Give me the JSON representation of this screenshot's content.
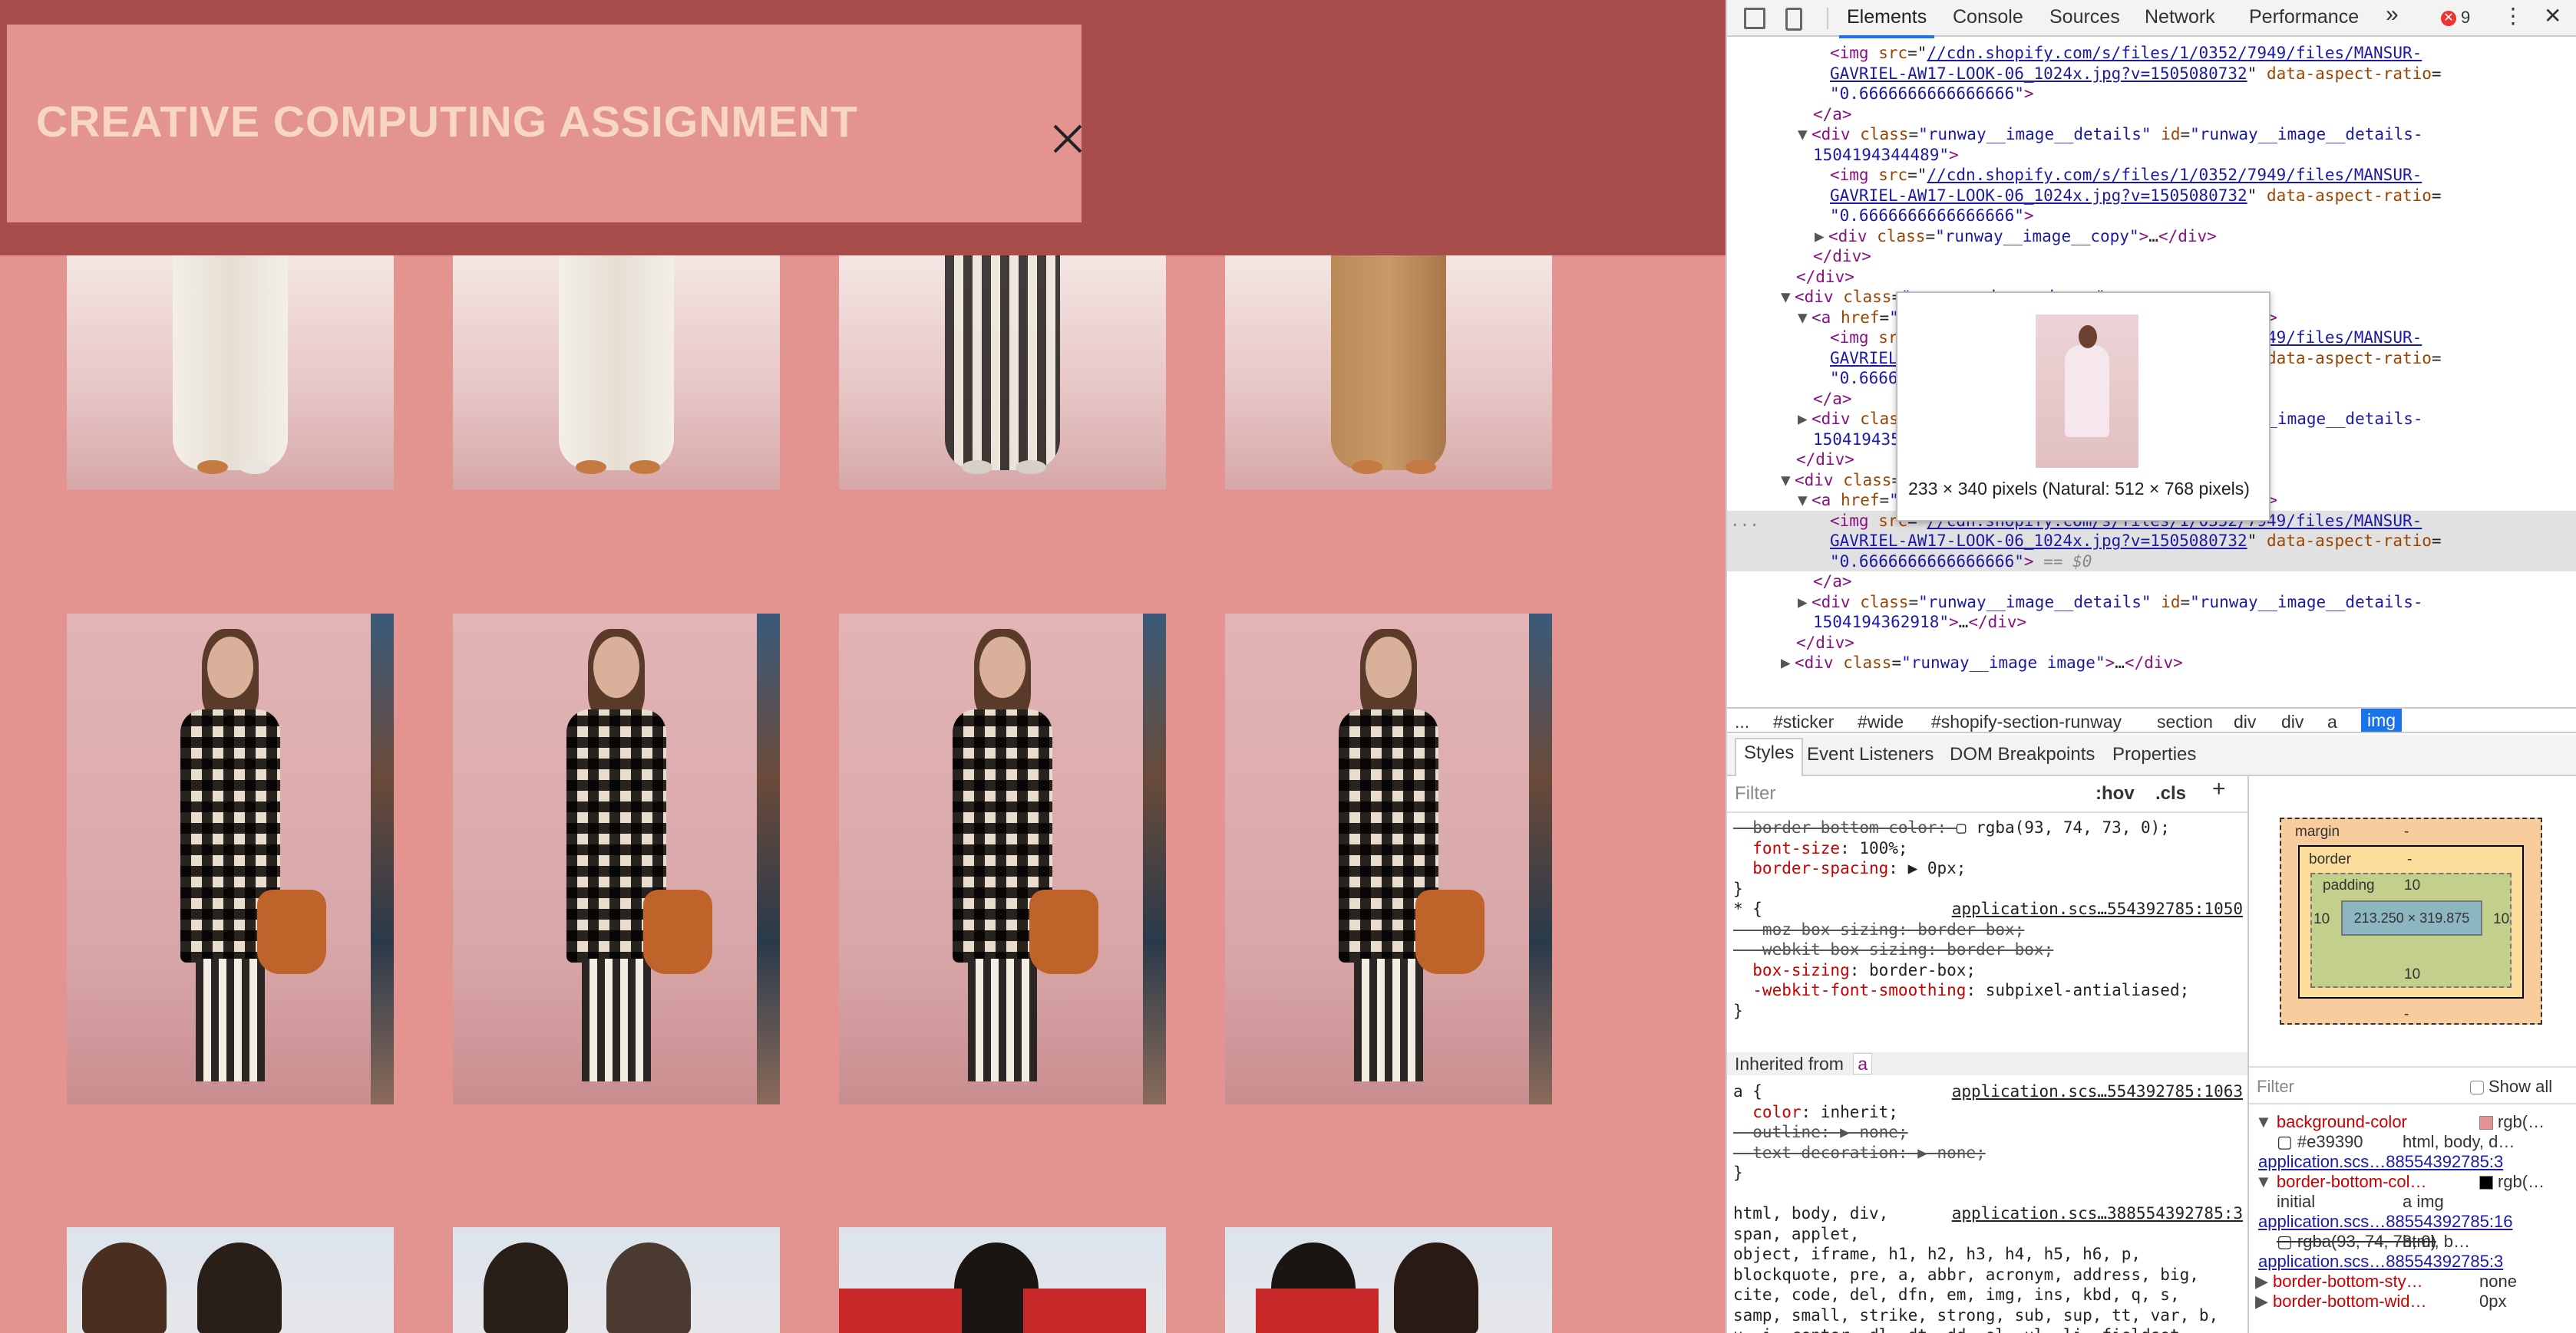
{
  "modal": {
    "title": "CREATIVE COMPUTING ASSIGNMENT",
    "close_icon": "close-icon"
  },
  "devtools": {
    "tabs": [
      "Elements",
      "Console",
      "Sources",
      "Network",
      "Performance"
    ],
    "more_tabs": "»",
    "error_count": "9",
    "error_icon": "error-icon",
    "dom_lines": [
      {
        "indent": 5,
        "parts": [
          [
            "tag",
            "<img "
          ],
          [
            "attr",
            "src"
          ],
          [
            "plain",
            "=\""
          ],
          [
            "link",
            "//cdn.shopify.com/s/files/1/0352/7949/files/MANSUR-"
          ]
        ]
      },
      {
        "indent": 5,
        "parts": [
          [
            "link",
            "GAVRIEL-AW17-LOOK-06_1024x.jpg?v=1505080732"
          ],
          [
            "plain",
            "\" "
          ],
          [
            "attr",
            "data-aspect-ratio"
          ],
          [
            "plain",
            "="
          ]
        ]
      },
      {
        "indent": 5,
        "parts": [
          [
            "val",
            "\"0.6666666666666666\""
          ],
          [
            "tag",
            ">"
          ]
        ]
      },
      {
        "indent": 4,
        "parts": [
          [
            "tag",
            "</a>"
          ]
        ]
      },
      {
        "indent": 4,
        "tri": "▼",
        "parts": [
          [
            "tag",
            "<div "
          ],
          [
            "attr",
            "class"
          ],
          [
            "plain",
            "="
          ],
          [
            "val",
            "\"runway__image__details\""
          ],
          [
            "plain",
            " "
          ],
          [
            "attr",
            "id"
          ],
          [
            "plain",
            "="
          ],
          [
            "val",
            "\"runway__image__details-"
          ]
        ]
      },
      {
        "indent": 4,
        "parts": [
          [
            "val",
            "1504194344489\""
          ],
          [
            "tag",
            ">"
          ]
        ]
      },
      {
        "indent": 5,
        "parts": [
          [
            "tag",
            "<img "
          ],
          [
            "attr",
            "src"
          ],
          [
            "plain",
            "=\""
          ],
          [
            "link",
            "//cdn.shopify.com/s/files/1/0352/7949/files/MANSUR-"
          ]
        ]
      },
      {
        "indent": 5,
        "parts": [
          [
            "link",
            "GAVRIEL-AW17-LOOK-06_1024x.jpg?v=1505080732"
          ],
          [
            "plain",
            "\" "
          ],
          [
            "attr",
            "data-aspect-ratio"
          ],
          [
            "plain",
            "="
          ]
        ]
      },
      {
        "indent": 5,
        "parts": [
          [
            "val",
            "\"0.6666666666666666\""
          ],
          [
            "tag",
            ">"
          ]
        ]
      },
      {
        "indent": 5,
        "tri": "▶",
        "parts": [
          [
            "tag",
            "<div "
          ],
          [
            "attr",
            "class"
          ],
          [
            "plain",
            "="
          ],
          [
            "val",
            "\"runway__image__copy\""
          ],
          [
            "tag",
            ">"
          ],
          [
            "plain",
            "…"
          ],
          [
            "tag",
            "</div>"
          ]
        ]
      },
      {
        "indent": 4,
        "parts": [
          [
            "tag",
            "</div>"
          ]
        ]
      },
      {
        "indent": 3,
        "parts": [
          [
            "tag",
            "</div>"
          ]
        ]
      },
      {
        "indent": 3,
        "tri": "▼",
        "parts": [
          [
            "tag",
            "<div "
          ],
          [
            "attr",
            "class"
          ],
          [
            "plain",
            "="
          ],
          [
            "val",
            "\"runway__image image\""
          ],
          [
            "tag",
            ">"
          ]
        ]
      },
      {
        "indent": 4,
        "tri": "▼",
        "parts": [
          [
            "tag",
            "<a "
          ],
          [
            "attr",
            "href"
          ],
          [
            "plain",
            "="
          ],
          [
            "val",
            "\"#runway__image__details-1504194354687\""
          ],
          [
            "tag",
            ">"
          ]
        ]
      },
      {
        "indent": 5,
        "parts": [
          [
            "tag",
            "<img "
          ],
          [
            "attr",
            "src"
          ],
          [
            "plain",
            "=\""
          ],
          [
            "link",
            "//cdn.shopify.com/s/files/1/0352/7949/files/MANSUR-"
          ]
        ]
      },
      {
        "indent": 5,
        "parts": [
          [
            "link",
            "GAVRIEL-AW17-LOOK-06_1024x.jpg?v=1505080732"
          ],
          [
            "plain",
            "\" "
          ],
          [
            "attr",
            "data-aspect-ratio"
          ],
          [
            "plain",
            "="
          ]
        ]
      },
      {
        "indent": 5,
        "parts": [
          [
            "val",
            "\"0.6666666666666666\""
          ],
          [
            "tag",
            ">"
          ]
        ]
      },
      {
        "indent": 4,
        "parts": [
          [
            "tag",
            "</a>"
          ]
        ]
      },
      {
        "indent": 4,
        "tri": "▶",
        "parts": [
          [
            "tag",
            "<div "
          ],
          [
            "attr",
            "class"
          ],
          [
            "plain",
            "="
          ],
          [
            "val",
            "\"runway__image__details\""
          ],
          [
            "plain",
            " "
          ],
          [
            "attr",
            "id"
          ],
          [
            "plain",
            "="
          ],
          [
            "val",
            "\"runway__image__details-"
          ]
        ]
      },
      {
        "indent": 4,
        "parts": [
          [
            "val",
            "1504194354687\""
          ],
          [
            "tag",
            ">"
          ],
          [
            "plain",
            "…"
          ],
          [
            "tag",
            "</div>"
          ]
        ]
      },
      {
        "indent": 3,
        "parts": [
          [
            "tag",
            "</div>"
          ]
        ]
      },
      {
        "indent": 3,
        "tri": "▼",
        "parts": [
          [
            "tag",
            "<div "
          ],
          [
            "attr",
            "class"
          ],
          [
            "plain",
            "="
          ],
          [
            "val",
            "\"runway__image image\""
          ],
          [
            "tag",
            ">"
          ]
        ]
      },
      {
        "indent": 4,
        "tri": "▼",
        "parts": [
          [
            "tag",
            "<a "
          ],
          [
            "attr",
            "href"
          ],
          [
            "plain",
            "="
          ],
          [
            "val",
            "\"#runway__image__details-1504194362918\""
          ],
          [
            "tag",
            ">"
          ]
        ]
      },
      {
        "indent": 5,
        "hl": true,
        "parts": [
          [
            "tag",
            "<img "
          ],
          [
            "attr",
            "src"
          ],
          [
            "plain",
            "=\""
          ],
          [
            "link",
            "//cdn.shopify.com/s/files/1/0352/7949/files/MANSUR-"
          ]
        ]
      },
      {
        "indent": 5,
        "hl": true,
        "parts": [
          [
            "link",
            "GAVRIEL-AW17-LOOK-06_1024x.jpg?v=1505080732"
          ],
          [
            "plain",
            "\" "
          ],
          [
            "attr",
            "data-aspect-ratio"
          ],
          [
            "plain",
            "="
          ]
        ]
      },
      {
        "indent": 5,
        "hl": true,
        "parts": [
          [
            "val",
            "\"0.6666666666666666\""
          ],
          [
            "tag",
            ">"
          ],
          [
            "eqs",
            " == $0"
          ]
        ]
      },
      {
        "indent": 4,
        "parts": [
          [
            "tag",
            "</a>"
          ]
        ]
      },
      {
        "indent": 4,
        "tri": "▶",
        "parts": [
          [
            "tag",
            "<div "
          ],
          [
            "attr",
            "class"
          ],
          [
            "plain",
            "="
          ],
          [
            "val",
            "\"runway__image__details\""
          ],
          [
            "plain",
            " "
          ],
          [
            "attr",
            "id"
          ],
          [
            "plain",
            "="
          ],
          [
            "val",
            "\"runway__image__details-"
          ]
        ]
      },
      {
        "indent": 4,
        "parts": [
          [
            "val",
            "1504194362918\""
          ],
          [
            "tag",
            ">"
          ],
          [
            "plain",
            "…"
          ],
          [
            "tag",
            "</div>"
          ]
        ]
      },
      {
        "indent": 3,
        "parts": [
          [
            "tag",
            "</div>"
          ]
        ]
      },
      {
        "indent": 3,
        "tri": "▶",
        "parts": [
          [
            "tag",
            "<div "
          ],
          [
            "attr",
            "class"
          ],
          [
            "plain",
            "="
          ],
          [
            "val",
            "\"runway__image image\""
          ],
          [
            "tag",
            ">"
          ],
          [
            "plain",
            "…"
          ],
          [
            "tag",
            "</div>"
          ]
        ]
      }
    ],
    "tooltip_caption": "233 × 340 pixels (Natural: 512 × 768 pixels)",
    "breadcrumbs": [
      "...",
      "#sticker",
      "#wide",
      "#shopify-section-runway",
      "section",
      "div",
      "div",
      "a",
      "img"
    ],
    "styles_tabs": [
      "Styles",
      "Event Listeners",
      "DOM Breakpoints",
      "Properties"
    ],
    "styles_filter": "Filter",
    "styles_hov": ":hov",
    "styles_cls": ".cls",
    "styles_add": "+",
    "style_lines": [
      {
        "parts": [
          [
            "strike",
            "  border-bottom-color: "
          ],
          [
            "pval",
            "▢ rgba(93, 74, 73, 0);"
          ]
        ]
      },
      {
        "parts": [
          [
            "prop",
            "  font-size"
          ],
          [
            "pval",
            ": 100%;"
          ]
        ]
      },
      {
        "parts": [
          [
            "prop",
            "  border-spacing"
          ],
          [
            "pval",
            ": ▶ 0px;"
          ]
        ]
      },
      {
        "parts": [
          [
            "sel",
            "}"
          ]
        ]
      },
      {
        "parts": [
          [
            "sel",
            "* {"
          ]
        ],
        "src": "application.scs…554392785:1050"
      },
      {
        "parts": [
          [
            "strike",
            "  -moz-box-sizing: border-box;"
          ]
        ]
      },
      {
        "parts": [
          [
            "strike",
            "  -webkit-box-sizing: border-box;"
          ]
        ]
      },
      {
        "parts": [
          [
            "prop",
            "  box-sizing"
          ],
          [
            "pval",
            ": border-box;"
          ]
        ]
      },
      {
        "parts": [
          [
            "prop",
            "  -webkit-font-smoothing"
          ],
          [
            "pval",
            ": subpixel-antialiased;"
          ]
        ]
      },
      {
        "parts": [
          [
            "sel",
            "}"
          ]
        ]
      }
    ],
    "inherited_label": "Inherited from",
    "inherited_tag": "a",
    "style_lines2": [
      {
        "parts": [
          [
            "sel",
            "a {"
          ]
        ],
        "src": "application.scs…554392785:1063"
      },
      {
        "parts": [
          [
            "prop",
            "  color"
          ],
          [
            "pval",
            ": inherit;"
          ]
        ]
      },
      {
        "parts": [
          [
            "strike",
            "  outline: ▶ none;"
          ]
        ]
      },
      {
        "parts": [
          [
            "strike",
            "  text-decoration: ▶ none;"
          ]
        ]
      },
      {
        "parts": [
          [
            "sel",
            "}"
          ]
        ]
      },
      {
        "parts": [
          [
            "sel",
            ""
          ]
        ]
      },
      {
        "parts": [
          [
            "sel",
            "html, body, div,"
          ]
        ],
        "src": "application.scs…388554392785:3"
      },
      {
        "parts": [
          [
            "sel",
            "span, applet,"
          ]
        ]
      },
      {
        "parts": [
          [
            "sel",
            "object, iframe, h1, h2, h3, h4, h5, h6, p,"
          ]
        ]
      },
      {
        "parts": [
          [
            "sel",
            "blockquote, pre, a, abbr, acronym, address, big,"
          ]
        ]
      },
      {
        "parts": [
          [
            "sel",
            "cite, code, del, dfn, em, img, ins, kbd, q, s,"
          ]
        ]
      },
      {
        "parts": [
          [
            "sel",
            "samp, small, strike, strong, sub, sup, tt, var, b,"
          ]
        ]
      },
      {
        "parts": [
          [
            "sel",
            "u, i, center, dl, dt, dd, ol, ul, li, fieldset,"
          ]
        ]
      }
    ],
    "box_model": {
      "margin": "margin",
      "border": "border",
      "padding": "padding",
      "content": "213.250 × 319.875",
      "padding_value": "10",
      "dash": "-"
    },
    "computed_filter": "Filter",
    "show_all": "Show all",
    "computed": [
      {
        "tri": "▼",
        "name": "background-color",
        "val": "rgb(…",
        "swatch": "#e39390"
      },
      {
        "indent": true,
        "name": "▢ #e39390",
        "val": "html, body, d…"
      },
      {
        "indent": true,
        "link": "application.scs…88554392785:3"
      },
      {
        "tri": "▼",
        "name": "border-bottom-col…",
        "val": "rgb(…",
        "swatch": "#000000"
      },
      {
        "indent": true,
        "name": "initial",
        "val": "a img"
      },
      {
        "indent": true,
        "link": "application.scs…88554392785:16"
      },
      {
        "indent": true,
        "name": "▢ rgba(93, 74, 73, 0)",
        "val": "html, b…",
        "strike": true
      },
      {
        "indent": true,
        "link": "application.scs…88554392785:3"
      },
      {
        "tri": "▶",
        "name": "border-bottom-sty…",
        "val": "none"
      },
      {
        "tri": "▶",
        "name": "border-bottom-wid…",
        "val": "0px"
      }
    ]
  }
}
